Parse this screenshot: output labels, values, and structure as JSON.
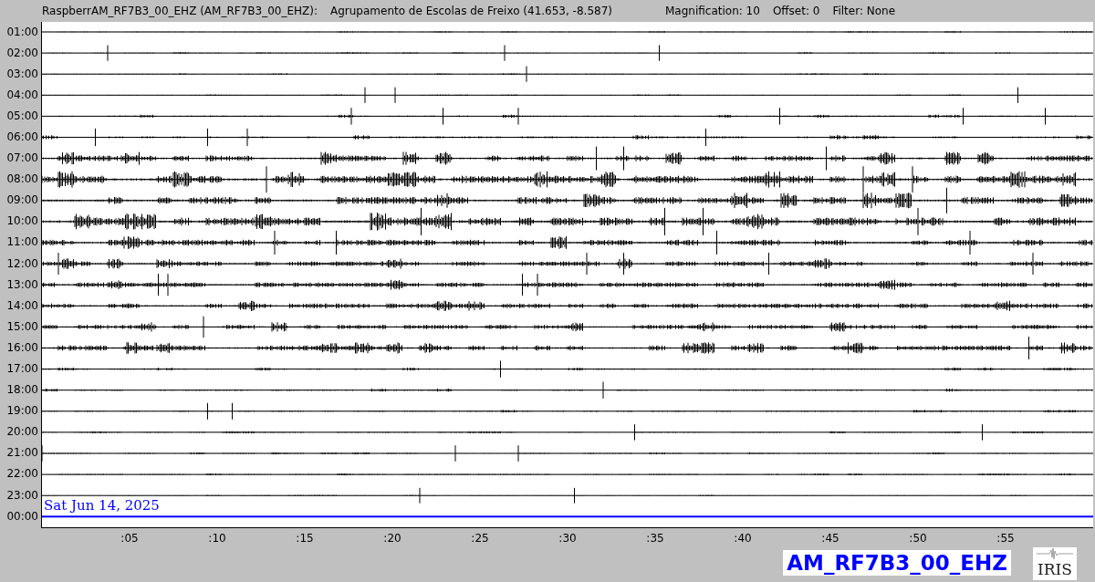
{
  "header": {
    "station": "RaspberrAM_RF7B3_00_EHZ (AM_RF7B3_00_EHZ):",
    "location": "Agrupamento de Escolas de Freixo (41.653, -8.587)",
    "magnification": "Magnification: 10",
    "offset": "Offset: 0",
    "filter": "Filter: None"
  },
  "rows": [
    {
      "label": "01:00",
      "current": false
    },
    {
      "label": "02:00",
      "current": false
    },
    {
      "label": "03:00",
      "current": false
    },
    {
      "label": "04:00",
      "current": false
    },
    {
      "label": "05:00",
      "current": false
    },
    {
      "label": "06:00",
      "current": false
    },
    {
      "label": "07:00",
      "current": false
    },
    {
      "label": "08:00",
      "current": false
    },
    {
      "label": "09:00",
      "current": false
    },
    {
      "label": "10:00",
      "current": false
    },
    {
      "label": "11:00",
      "current": false
    },
    {
      "label": "12:00",
      "current": false
    },
    {
      "label": "13:00",
      "current": false
    },
    {
      "label": "14:00",
      "current": false
    },
    {
      "label": "15:00",
      "current": false
    },
    {
      "label": "16:00",
      "current": false
    },
    {
      "label": "17:00",
      "current": false
    },
    {
      "label": "18:00",
      "current": false
    },
    {
      "label": "19:00",
      "current": false
    },
    {
      "label": "20:00",
      "current": false
    },
    {
      "label": "21:00",
      "current": false
    },
    {
      "label": "22:00",
      "current": false
    },
    {
      "label": "23:00",
      "current": false
    },
    {
      "label": "00:00",
      "current": true
    }
  ],
  "date_label": "Sat Jun 14, 2025",
  "x_ticks": [
    ":05",
    ":10",
    ":15",
    ":20",
    ":25",
    ":30",
    ":35",
    ":40",
    ":45",
    ":50",
    ":55"
  ],
  "channel_label": "AM_RF7B3_00_EHZ",
  "logo": "IRIS"
}
